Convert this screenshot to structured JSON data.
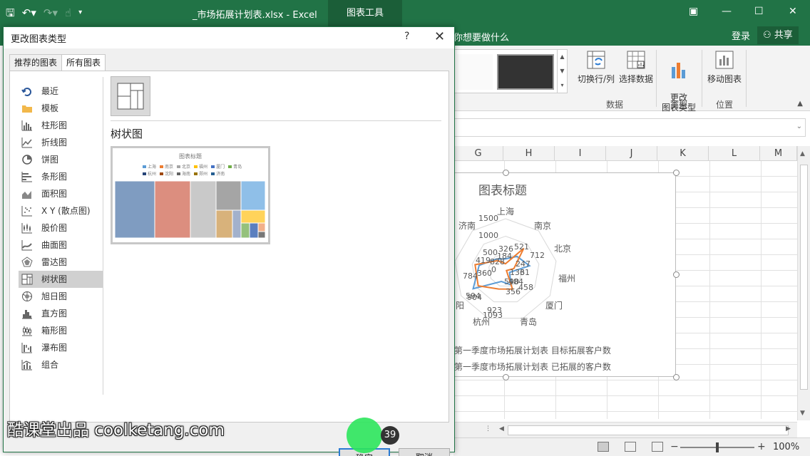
{
  "window": {
    "doc_title": "_市场拓展计划表.xlsx - Excel",
    "context_tab": "图表工具",
    "tell_me": "你想要做什么",
    "sign_in": "登录",
    "share": "共享",
    "colors": {
      "excel_green": "#217346",
      "dark_green": "#1b5e38"
    }
  },
  "ribbon": {
    "buttons": [
      {
        "label": "切换行/列",
        "icon": "switch-row-col-icon"
      },
      {
        "label": "选择数据",
        "icon": "select-data-icon"
      },
      {
        "label": "更改\n图表类型",
        "icon": "change-chart-type-icon"
      },
      {
        "label": "移动图表",
        "icon": "move-chart-icon"
      }
    ],
    "groups": [
      "数据",
      "类型",
      "位置"
    ]
  },
  "sheet": {
    "columns": [
      "G",
      "H",
      "I",
      "J",
      "K",
      "L",
      "M"
    ]
  },
  "chart": {
    "title": "图表标题",
    "categories": [
      "上海",
      "南京",
      "北京",
      "福州",
      "厦门",
      "青岛",
      "杭州",
      "阳",
      "济南"
    ],
    "ticks": [
      "1500",
      "1000",
      "500",
      "0"
    ],
    "legend": [
      "第一季度市场拓展计划表 目标拓展客户数",
      "第一季度市场拓展计划表 已拓展的客户数"
    ],
    "data_labels": [
      "326",
      "521",
      "712",
      "184",
      "828",
      "247",
      "31",
      "136",
      "458",
      "356",
      "923",
      "1093",
      "784",
      "360",
      "419",
      "904",
      "594",
      "590",
      "484"
    ],
    "colors": {
      "series1": "#5b9bd5",
      "series2": "#ed7d31"
    }
  },
  "dialog": {
    "title": "更改图表类型",
    "help": "?",
    "close": "✕",
    "tabs": [
      "推荐的图表",
      "所有图表"
    ],
    "active_tab": 1,
    "chart_types": [
      {
        "label": "最近",
        "icon": "recent-icon"
      },
      {
        "label": "模板",
        "icon": "folder-icon"
      },
      {
        "label": "柱形图",
        "icon": "column-chart-icon"
      },
      {
        "label": "折线图",
        "icon": "line-chart-icon"
      },
      {
        "label": "饼图",
        "icon": "pie-chart-icon"
      },
      {
        "label": "条形图",
        "icon": "bar-chart-icon"
      },
      {
        "label": "面积图",
        "icon": "area-chart-icon"
      },
      {
        "label": "X Y (散点图)",
        "icon": "scatter-chart-icon"
      },
      {
        "label": "股价图",
        "icon": "stock-chart-icon"
      },
      {
        "label": "曲面图",
        "icon": "surface-chart-icon"
      },
      {
        "label": "雷达图",
        "icon": "radar-chart-icon"
      },
      {
        "label": "树状图",
        "icon": "treemap-chart-icon"
      },
      {
        "label": "旭日图",
        "icon": "sunburst-chart-icon"
      },
      {
        "label": "直方图",
        "icon": "histogram-chart-icon"
      },
      {
        "label": "箱形图",
        "icon": "box-whisker-chart-icon"
      },
      {
        "label": "瀑布图",
        "icon": "waterfall-chart-icon"
      },
      {
        "label": "组合",
        "icon": "combo-chart-icon"
      }
    ],
    "selected_type": 11,
    "subtype_name": "树状图",
    "preview": {
      "title": "图表标题",
      "legend": [
        "上海",
        "南京",
        "北京",
        "福州",
        "厦门",
        "青岛",
        "杭州",
        "沈阳",
        "海南",
        "郑州",
        "济南"
      ],
      "legend_colors": [
        "#5b9bd5",
        "#ed7d31",
        "#a5a5a5",
        "#ffc000",
        "#4472c4",
        "#70ad47",
        "#264478",
        "#9e480e",
        "#636363",
        "#997300",
        "#255e91"
      ]
    },
    "ok": "确定",
    "cancel": "取消"
  },
  "overlay": {
    "step_badge": "39",
    "watermark": "酷课堂出品 coolketang.com"
  },
  "status": {
    "zoom": "100%"
  }
}
